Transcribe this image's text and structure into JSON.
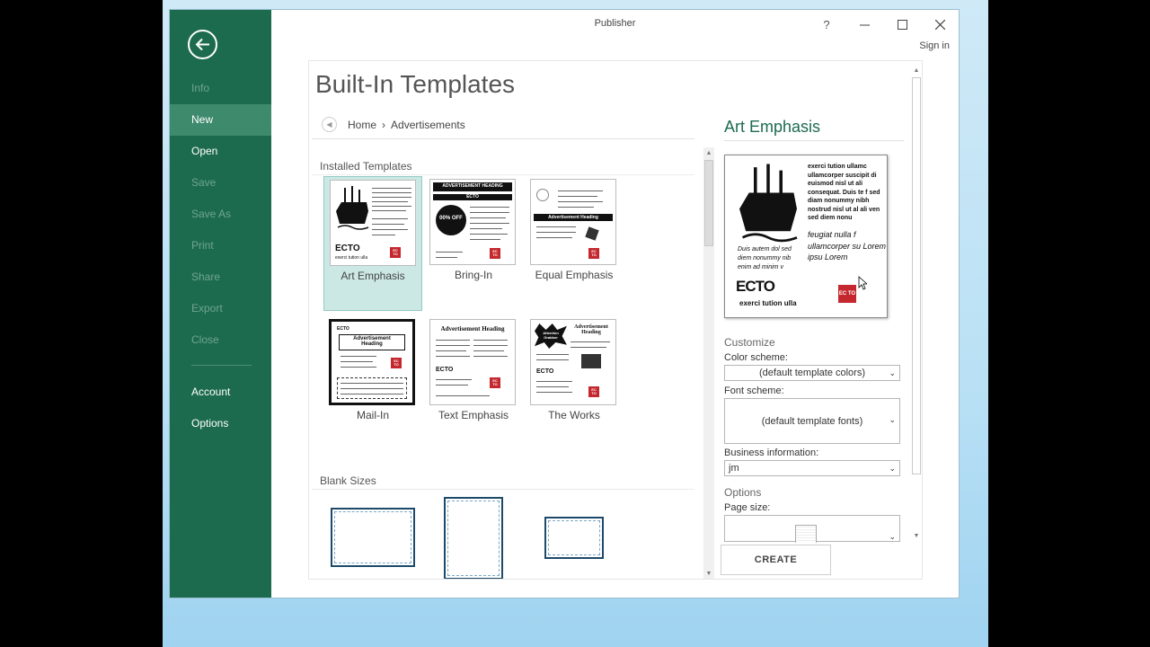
{
  "window": {
    "title": "Publisher",
    "help": "?",
    "sign_in": "Sign in"
  },
  "nav": {
    "items": [
      {
        "label": "Info"
      },
      {
        "label": "New"
      },
      {
        "label": "Open"
      },
      {
        "label": "Save"
      },
      {
        "label": "Save As"
      },
      {
        "label": "Print"
      },
      {
        "label": "Share"
      },
      {
        "label": "Export"
      },
      {
        "label": "Close"
      },
      {
        "label": "Account"
      },
      {
        "label": "Options"
      }
    ]
  },
  "main": {
    "title": "Built-In Templates",
    "breadcrumb": {
      "home": "Home",
      "separator": "›",
      "current": "Advertisements"
    },
    "installed_label": "Installed Templates",
    "blank_label": "Blank Sizes",
    "templates": [
      {
        "label": "Art Emphasis"
      },
      {
        "label": "Bring-In"
      },
      {
        "label": "Equal Emphasis"
      },
      {
        "label": "Mail-In"
      },
      {
        "label": "Text Emphasis"
      },
      {
        "label": "The Works"
      }
    ],
    "thumb_text": {
      "art": {
        "ecto": "ECTO",
        "sub": "exerci tution ulla"
      },
      "bring_heading": "ADVERTISEMENT HEADING",
      "bring_ecto": "ECTO",
      "bring_off": "00% OFF",
      "equal_heading": "Advertisement Heading",
      "mail_heading": "Advertisement Heading",
      "mail_ecto": "ECTO",
      "text_heading": "Advertisement Heading",
      "text_ecto": "ECTO",
      "works_heading": "Advertisement Heading",
      "works_attention": "Attention Grabber",
      "works_ecto": "ECTO",
      "logo": "EC TO"
    }
  },
  "panel": {
    "name": "Art Emphasis",
    "preview": {
      "body1": "exerci tution ullamc ullamcorper suscipit di euismod nisl ut ali consequat. Duis te f sed diam nonummy nibh nostrud nisl ut al ali ven sed diem nonu",
      "italic_big": "feugiat nulla f ullamcorper su Lorem ipsu Lorem",
      "italic_small": "Duis autem dol sed diem nonummy nib enim ad minim v",
      "ecto": "ECTO",
      "sub": "exerci tution ulla",
      "logo": "EC TO"
    },
    "customize_label": "Customize",
    "color_scheme_label": "Color scheme:",
    "color_scheme_value": "(default template colors)",
    "font_scheme_label": "Font scheme:",
    "font_scheme_value": "(default template fonts)",
    "business_label": "Business information:",
    "business_value": "jm",
    "options_label": "Options",
    "page_size_label": "Page size:",
    "create_label": "CREATE"
  },
  "colors": {
    "backstage": "#1d6b4f",
    "accent_text": "#1d6b4f",
    "selected_tile": "#cce8e5"
  }
}
